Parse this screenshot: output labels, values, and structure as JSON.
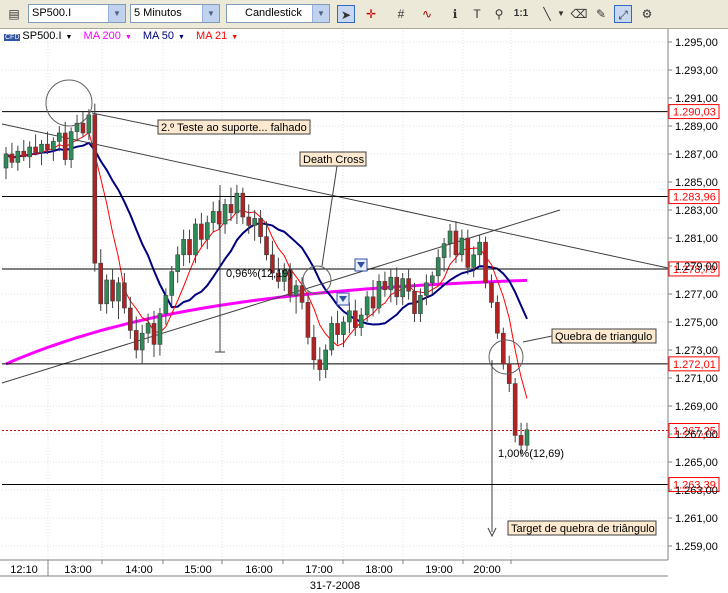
{
  "toolbar": {
    "symbol": "SP500.I",
    "interval": "5 Minutos",
    "chart_style": "Candlestick",
    "scale_label": "1:1"
  },
  "legend": {
    "badge": "CFD",
    "symbol": "SP500.I",
    "ma200": "MA 200",
    "ma50": "MA 50",
    "ma21": "MA 21",
    "colors": {
      "ma200": "#ff00ff",
      "ma50": "#000080",
      "ma21": "#ff0000"
    }
  },
  "chart_data": {
    "type": "candlestick",
    "date_label": "31-7-2008",
    "x_ticks": [
      "12:10",
      "13:00",
      "14:00",
      "15:00",
      "16:00",
      "17:00",
      "18:00",
      "19:00",
      "20:00"
    ],
    "y_ticks": [
      "1.295,00",
      "1.293,00",
      "1.291,00",
      "1.289,00",
      "1.287,00",
      "1.285,00",
      "1.283,00",
      "1.281,00",
      "1.279,00",
      "1.277,00",
      "1.275,00",
      "1.273,00",
      "1.271,00",
      "1.269,00",
      "1.267,00",
      "1.265,00",
      "1.263,00",
      "1.261,00",
      "1.259,00"
    ],
    "ylim": [
      1258.0,
      1296.0
    ],
    "price_levels": [
      {
        "label": "1.290,03",
        "value": 1290.03,
        "color": "#ff0000"
      },
      {
        "label": "1.283,96",
        "value": 1283.96,
        "color": "#ff0000"
      },
      {
        "label": "1.278,79",
        "value": 1278.79,
        "color": "#ff0000"
      },
      {
        "label": "1.272,01",
        "value": 1272.01,
        "color": "#ff0000"
      },
      {
        "label": "1.267,25",
        "value": 1267.25,
        "color": "#ff0000"
      },
      {
        "label": "1.263,39",
        "value": 1263.39,
        "color": "#ff0000"
      }
    ],
    "current_price": 1267.25,
    "annotations": [
      {
        "text": "2.º Teste ao suporte... falhado"
      },
      {
        "text": "Death Cross"
      },
      {
        "text": "Quebra de triangulo"
      },
      {
        "text": "Target de quebra de triângulo"
      }
    ],
    "measure_labels": [
      "0,96%(12,19)",
      "1,00%(12,69)"
    ],
    "candles": [
      [
        1286.0,
        1287.5,
        1285.2,
        1287.0
      ],
      [
        1287.0,
        1287.8,
        1286.0,
        1286.4
      ],
      [
        1286.4,
        1287.6,
        1285.8,
        1287.2
      ],
      [
        1287.2,
        1288.0,
        1286.5,
        1286.8
      ],
      [
        1286.8,
        1287.9,
        1286.0,
        1287.5
      ],
      [
        1287.5,
        1288.4,
        1286.9,
        1287.1
      ],
      [
        1287.1,
        1288.0,
        1286.2,
        1287.7
      ],
      [
        1287.7,
        1288.6,
        1287.0,
        1287.3
      ],
      [
        1287.3,
        1288.2,
        1286.5,
        1287.9
      ],
      [
        1287.9,
        1289.0,
        1287.2,
        1288.5
      ],
      [
        1288.5,
        1289.3,
        1286.2,
        1286.6
      ],
      [
        1286.6,
        1288.9,
        1286.0,
        1288.6
      ],
      [
        1288.6,
        1289.8,
        1287.9,
        1289.2
      ],
      [
        1289.2,
        1290.0,
        1288.2,
        1288.5
      ],
      [
        1288.5,
        1290.2,
        1288.0,
        1289.8
      ],
      [
        1289.8,
        1290.6,
        1278.6,
        1279.2
      ],
      [
        1279.2,
        1280.2,
        1275.8,
        1276.3
      ],
      [
        1276.3,
        1278.4,
        1275.6,
        1278.0
      ],
      [
        1278.0,
        1278.8,
        1276.0,
        1276.5
      ],
      [
        1276.5,
        1278.2,
        1275.2,
        1277.8
      ],
      [
        1277.8,
        1278.5,
        1275.6,
        1276.0
      ],
      [
        1276.0,
        1276.8,
        1273.8,
        1274.4
      ],
      [
        1274.4,
        1275.4,
        1272.4,
        1273.0
      ],
      [
        1273.0,
        1274.8,
        1272.0,
        1274.2
      ],
      [
        1274.2,
        1275.6,
        1273.5,
        1274.9
      ],
      [
        1274.9,
        1275.8,
        1272.5,
        1273.4
      ],
      [
        1273.4,
        1276.0,
        1272.6,
        1275.6
      ],
      [
        1275.6,
        1277.4,
        1274.8,
        1276.9
      ],
      [
        1276.9,
        1279.0,
        1276.2,
        1278.6
      ],
      [
        1278.6,
        1280.4,
        1277.8,
        1279.8
      ],
      [
        1279.8,
        1281.6,
        1279.0,
        1280.9
      ],
      [
        1280.9,
        1281.6,
        1279.2,
        1279.8
      ],
      [
        1279.8,
        1282.4,
        1279.2,
        1282.0
      ],
      [
        1282.0,
        1282.8,
        1280.4,
        1280.9
      ],
      [
        1280.9,
        1282.6,
        1280.2,
        1282.1
      ],
      [
        1282.1,
        1283.6,
        1281.4,
        1282.9
      ],
      [
        1282.9,
        1283.7,
        1281.6,
        1282.0
      ],
      [
        1282.0,
        1283.8,
        1281.3,
        1283.4
      ],
      [
        1283.4,
        1284.6,
        1282.2,
        1282.8
      ],
      [
        1282.8,
        1284.8,
        1282.0,
        1284.2
      ],
      [
        1284.2,
        1284.6,
        1282.0,
        1282.5
      ],
      [
        1282.5,
        1283.4,
        1281.3,
        1281.9
      ],
      [
        1281.9,
        1283.0,
        1280.8,
        1282.4
      ],
      [
        1282.4,
        1283.0,
        1280.6,
        1281.1
      ],
      [
        1281.1,
        1282.2,
        1279.4,
        1279.8
      ],
      [
        1279.8,
        1280.8,
        1278.0,
        1278.5
      ],
      [
        1278.5,
        1279.6,
        1277.4,
        1277.9
      ],
      [
        1277.9,
        1279.2,
        1277.2,
        1278.7
      ],
      [
        1278.7,
        1279.2,
        1276.4,
        1276.9
      ],
      [
        1276.9,
        1278.0,
        1275.6,
        1277.6
      ],
      [
        1277.6,
        1278.2,
        1275.9,
        1276.4
      ],
      [
        1276.4,
        1277.2,
        1273.4,
        1273.9
      ],
      [
        1273.9,
        1274.8,
        1271.6,
        1272.3
      ],
      [
        1272.3,
        1273.2,
        1270.8,
        1271.6
      ],
      [
        1271.6,
        1273.4,
        1271.0,
        1273.0
      ],
      [
        1273.0,
        1275.4,
        1272.6,
        1274.9
      ],
      [
        1274.9,
        1275.8,
        1273.4,
        1274.1
      ],
      [
        1274.1,
        1275.4,
        1273.2,
        1275.0
      ],
      [
        1275.0,
        1276.4,
        1274.2,
        1275.8
      ],
      [
        1275.8,
        1276.6,
        1274.0,
        1274.6
      ],
      [
        1274.6,
        1276.0,
        1274.0,
        1275.5
      ],
      [
        1275.5,
        1277.2,
        1275.0,
        1276.8
      ],
      [
        1276.8,
        1278.0,
        1275.4,
        1276.0
      ],
      [
        1276.0,
        1278.4,
        1275.6,
        1277.9
      ],
      [
        1277.9,
        1278.6,
        1276.8,
        1277.3
      ],
      [
        1277.3,
        1278.8,
        1276.4,
        1278.2
      ],
      [
        1278.2,
        1278.9,
        1276.2,
        1276.8
      ],
      [
        1276.8,
        1278.5,
        1276.2,
        1278.1
      ],
      [
        1278.1,
        1278.8,
        1276.6,
        1277.2
      ],
      [
        1277.2,
        1277.8,
        1275.0,
        1275.6
      ],
      [
        1275.6,
        1277.4,
        1275.0,
        1276.9
      ],
      [
        1276.9,
        1278.4,
        1276.2,
        1277.8
      ],
      [
        1277.8,
        1278.6,
        1277.0,
        1278.3
      ],
      [
        1278.3,
        1280.2,
        1277.8,
        1279.6
      ],
      [
        1279.6,
        1281.0,
        1278.6,
        1280.6
      ],
      [
        1280.6,
        1282.0,
        1279.6,
        1281.5
      ],
      [
        1281.5,
        1282.2,
        1279.2,
        1279.8
      ],
      [
        1279.8,
        1281.6,
        1279.3,
        1281.0
      ],
      [
        1281.0,
        1281.6,
        1278.4,
        1278.9
      ],
      [
        1278.9,
        1280.4,
        1278.2,
        1279.8
      ],
      [
        1279.8,
        1281.2,
        1279.0,
        1280.7
      ],
      [
        1280.7,
        1281.1,
        1277.4,
        1277.8
      ],
      [
        1277.8,
        1278.4,
        1276.0,
        1276.4
      ],
      [
        1276.4,
        1276.9,
        1273.8,
        1274.2
      ],
      [
        1274.2,
        1274.6,
        1271.6,
        1272.0
      ],
      [
        1272.0,
        1272.6,
        1270.0,
        1270.6
      ],
      [
        1270.6,
        1271.0,
        1266.4,
        1266.9
      ],
      [
        1266.9,
        1267.8,
        1265.4,
        1266.2
      ],
      [
        1266.2,
        1267.8,
        1265.8,
        1267.3
      ]
    ]
  }
}
